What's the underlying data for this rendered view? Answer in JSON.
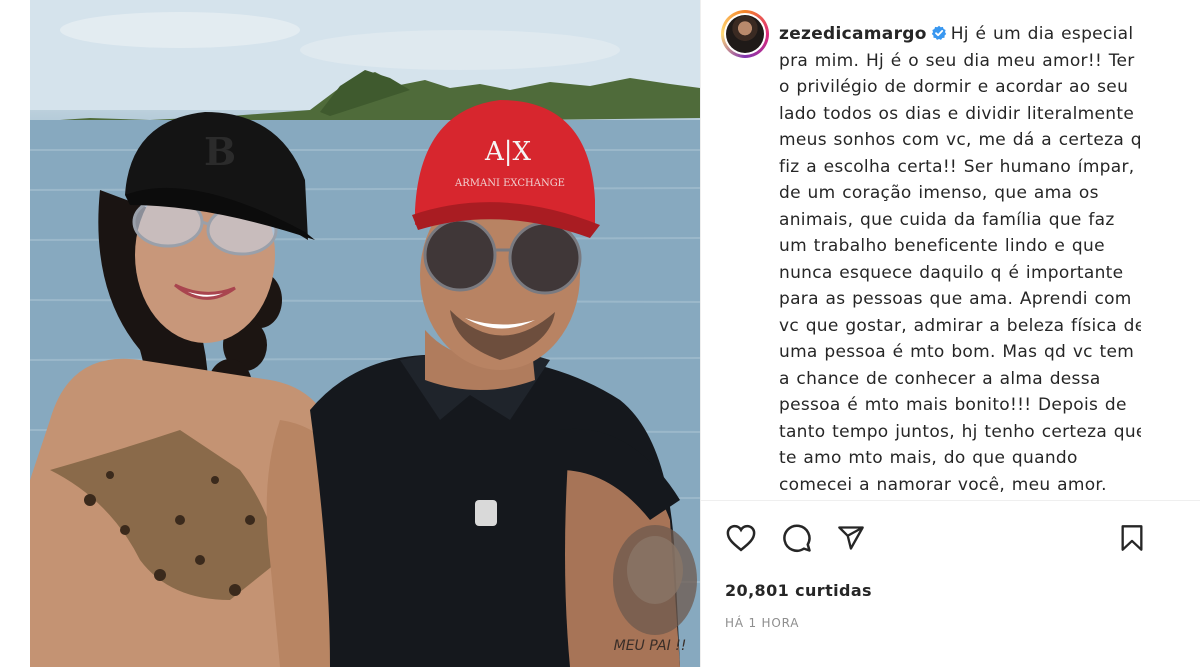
{
  "post": {
    "username": "zezedicamargo",
    "verified": true,
    "caption": "Hj é um dia especial pra mim. Hj é o seu dia meu amor!! Ter o privilégio de dormir e acordar ao seu lado todos os dias e dividir literalmente meus sonhos com vc, me dá a certeza q fiz a escolha certa!! Ser humano ímpar, de um coração imenso, que ama os animais, que cuida da família que faz um trabalho beneficente lindo e que nunca esquece daquilo q é importante para as pessoas que ama. Aprendi com vc que gostar, admirar a beleza física de uma pessoa é mto bom. Mas qd vc tem a chance de conhecer a alma dessa pessoa é mto mais bonito!!! Depois de tanto tempo juntos, hj tenho certeza que te amo mto mais, do que quando comecei a namorar você, meu amor.",
    "likes": "20,801 curtidas",
    "time_ago": "HÁ 1 HORA"
  },
  "photo": {
    "cap_left_logo": "B",
    "cap_right_logo": "A|X",
    "cap_right_text": "ARMANI EXCHANGE",
    "tattoo_text": "MEU PAI !!"
  },
  "icons": {
    "like": "heart-icon",
    "comment": "comment-icon",
    "share": "paper-plane-icon",
    "save": "bookmark-icon",
    "verified": "verified-badge-icon"
  },
  "colors": {
    "text": "#262626",
    "secondary": "#8e8e8e",
    "verified": "#3897f0",
    "red_cap": "#d7262e"
  }
}
